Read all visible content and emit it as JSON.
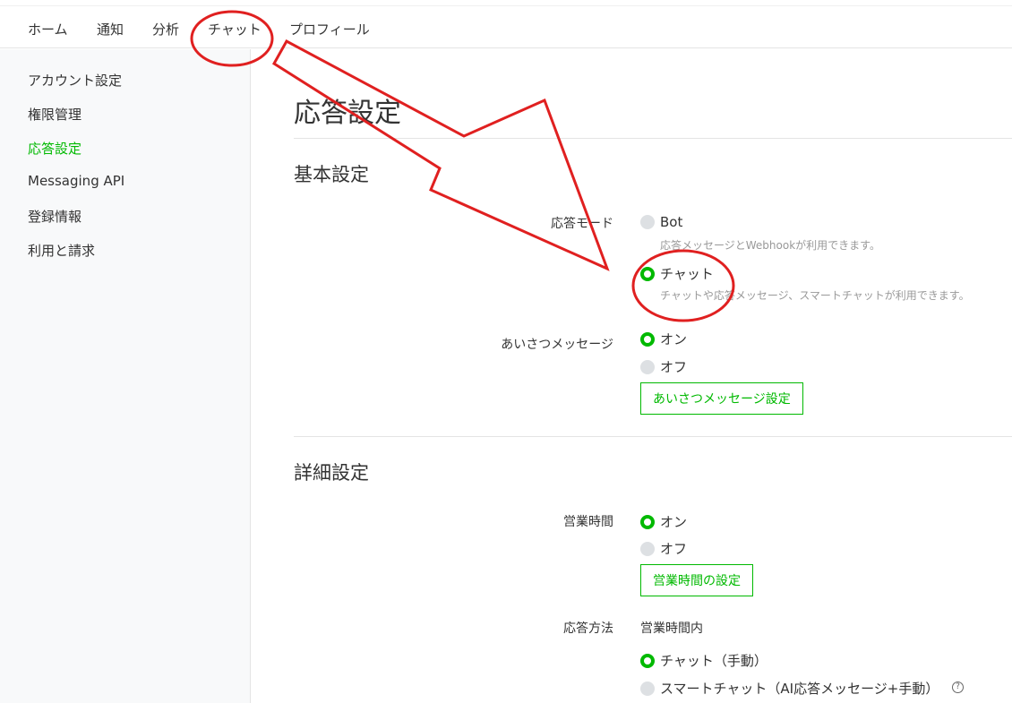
{
  "nav": {
    "tabs": [
      {
        "label": "ホーム"
      },
      {
        "label": "通知"
      },
      {
        "label": "分析"
      },
      {
        "label": "チャット"
      },
      {
        "label": "プロフィール"
      }
    ]
  },
  "sidebar": {
    "items": [
      {
        "label": "アカウント設定"
      },
      {
        "label": "権限管理"
      },
      {
        "label": "応答設定",
        "active": true
      },
      {
        "label": "Messaging API"
      },
      {
        "label": "登録情報"
      },
      {
        "label": "利用と請求"
      }
    ]
  },
  "page": {
    "title": "応答設定"
  },
  "basic": {
    "title": "基本設定",
    "response_mode": {
      "label": "応答モード",
      "options": [
        {
          "label": "Bot",
          "desc": "応答メッセージとWebhookが利用できます。",
          "checked": false
        },
        {
          "label": "チャット",
          "desc": "チャットや応答メッセージ、スマートチャットが利用できます。",
          "checked": true
        }
      ]
    },
    "greeting": {
      "label": "あいさつメッセージ",
      "options": [
        {
          "label": "オン",
          "checked": true
        },
        {
          "label": "オフ",
          "checked": false
        }
      ],
      "button": "あいさつメッセージ設定"
    }
  },
  "detail": {
    "title": "詳細設定",
    "business_hours": {
      "label": "営業時間",
      "options": [
        {
          "label": "オン",
          "checked": true
        },
        {
          "label": "オフ",
          "checked": false
        }
      ],
      "button": "営業時間の設定"
    },
    "response_method": {
      "label": "応答方法",
      "subheading": "営業時間内",
      "options": [
        {
          "label": "チャット（手動）",
          "checked": true
        },
        {
          "label": "スマートチャット（AI応答メッセージ+手動）",
          "checked": false
        }
      ],
      "help_icon": "?"
    }
  },
  "colors": {
    "accent": "#00b900",
    "annotation": "#e02020"
  }
}
